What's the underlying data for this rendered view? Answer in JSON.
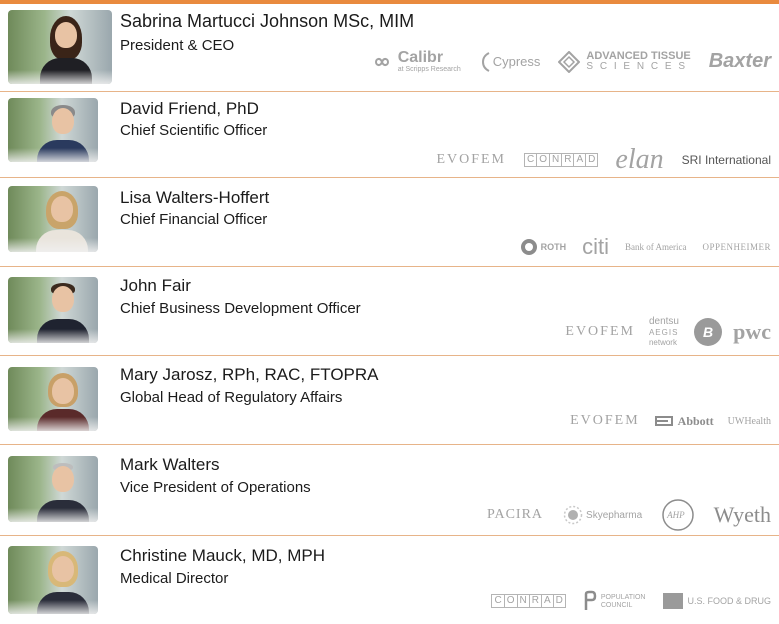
{
  "executives": [
    {
      "name": "Sabrina Martucci Johnson MSc, MIM",
      "title": "President & CEO",
      "logos": [
        {
          "text": "Calibr",
          "sub": "at Scripps Research",
          "icon": "infinity-icon"
        },
        {
          "text": "Cypress",
          "icon": "cypress-swirl-icon"
        },
        {
          "text": "ADVANCED TISSUE",
          "sub": "S C I E N C E S",
          "icon": "diamond-icon"
        },
        {
          "text": "Baxter"
        }
      ]
    },
    {
      "name": "David Friend, PhD",
      "title": "Chief Scientific Officer",
      "logos": [
        {
          "text": "EVOFEM"
        },
        {
          "text": "CONRAD",
          "letters": [
            "C",
            "O",
            "N",
            "R",
            "A",
            "D"
          ]
        },
        {
          "text": "elan"
        },
        {
          "text": "SRI International"
        }
      ]
    },
    {
      "name": "Lisa Walters-Hoffert",
      "title": "Chief Financial Officer",
      "logos": [
        {
          "text": "ROTH",
          "icon": "roth-circle-icon"
        },
        {
          "text": "citi"
        },
        {
          "text": "Bank of America"
        },
        {
          "text": "OPPENHEIMER"
        }
      ]
    },
    {
      "name": "John Fair",
      "title": "Chief Business Development Officer",
      "logos": [
        {
          "text": "EVOFEM"
        },
        {
          "text": "dentsu",
          "sub": "AEGIS",
          "sub2": "network"
        },
        {
          "text": "B",
          "icon": "circle-b-icon"
        },
        {
          "text": "pwc"
        }
      ]
    },
    {
      "name": "Mary Jarosz, RPh, RAC, FTOPRA",
      "title": "Global Head of Regulatory Affairs",
      "logos": [
        {
          "text": "EVOFEM"
        },
        {
          "text": "Abbott",
          "icon": "abbott-icon"
        },
        {
          "text": "UWHealth"
        }
      ]
    },
    {
      "name": "Mark Walters",
      "title": "Vice President of Operations",
      "logos": [
        {
          "text": "PACIRA"
        },
        {
          "text": "Skyepharma",
          "icon": "sun-icon"
        },
        {
          "text": "AHP",
          "icon": "ahp-circle-icon"
        },
        {
          "text": "Wyeth"
        }
      ]
    },
    {
      "name": "Christine Mauck, MD, MPH",
      "title": "Medical Director",
      "logos": [
        {
          "text": "CONRAD",
          "letters": [
            "C",
            "O",
            "N",
            "R",
            "A",
            "D"
          ]
        },
        {
          "text": "POPULATION",
          "sub": "COUNCIL",
          "icon": "population-council-icon"
        },
        {
          "text": "U.S. FOOD & DRUG",
          "icon": "fda-icon"
        }
      ]
    }
  ],
  "colors": {
    "accent_rule": "#e98a3e",
    "row_divider": "#e7b489",
    "logo_gray": "#a3a3a3"
  }
}
